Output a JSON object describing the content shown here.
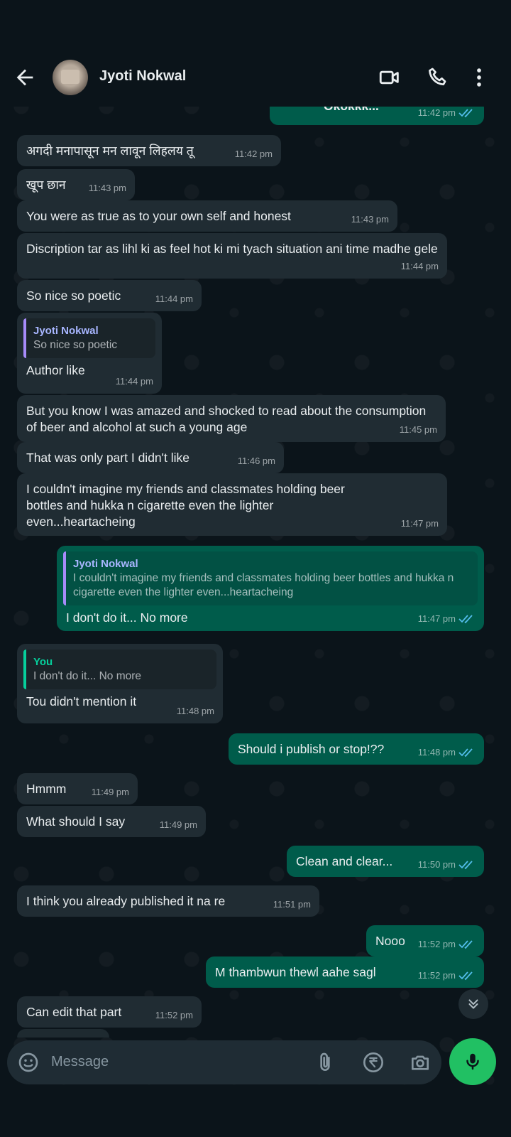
{
  "header": {
    "contact_name": "Jyoti Nokwal",
    "icons": [
      "back-arrow-icon",
      "video-call-icon",
      "voice-call-icon",
      "more-options-icon"
    ]
  },
  "colors": {
    "background": "#0b141a",
    "incoming_bubble": "#202c33",
    "outgoing_bubble": "#005c4b",
    "accent_green": "#21c063",
    "read_ticks": "#53bdeb"
  },
  "messages": [
    {
      "dir": "out",
      "text": "Okokkk...",
      "time": "11:42 pm",
      "read": true
    },
    {
      "dir": "in",
      "text": "अगदी मनापासून मन लावून लिहलय तू",
      "time": "11:42 pm"
    },
    {
      "dir": "in",
      "text": "खूप छान",
      "time": "11:43 pm"
    },
    {
      "dir": "in",
      "text": "You were as true as to your own self and honest",
      "time": "11:43 pm"
    },
    {
      "dir": "in",
      "text": "Discription tar as lihl ki as feel hot ki mi tyach situation ani time madhe gele",
      "time": "11:44 pm"
    },
    {
      "dir": "in",
      "text": "So nice so poetic",
      "time": "11:44 pm"
    },
    {
      "dir": "in",
      "quote_name": "Jyoti Nokwal",
      "quote_text": "So nice so poetic",
      "text": "Author like",
      "time": "11:44 pm"
    },
    {
      "dir": "in",
      "text": "But you know I was amazed and shocked to read about the consumption of beer and alcohol at such a young age",
      "time": "11:45 pm"
    },
    {
      "dir": "in",
      "text": "That was only part I didn't like",
      "time": "11:46 pm"
    },
    {
      "dir": "in",
      "text": "I couldn't imagine my friends and classmates holding beer bottles and hukka n cigarette even the lighter even...heartacheing",
      "time": "11:47 pm"
    },
    {
      "dir": "out",
      "quote_name": "Jyoti Nokwal",
      "quote_text": "I couldn't imagine my friends and classmates holding beer bottles and hukka n cigarette even the lighter even...heartacheing",
      "text": "I don't do it... No more",
      "time": "11:47 pm",
      "read": true
    },
    {
      "dir": "in",
      "quote_name": "You",
      "quote_text": "I don't do it... No more",
      "text": "Tou didn't mention it",
      "time": "11:48 pm"
    },
    {
      "dir": "out",
      "text": "Should i publish or stop!??",
      "time": "11:48 pm",
      "read": true
    },
    {
      "dir": "in",
      "text": "Hmmm",
      "time": "11:49 pm"
    },
    {
      "dir": "in",
      "text": "What should I say",
      "time": "11:49 pm"
    },
    {
      "dir": "out",
      "text": "Clean and clear...",
      "time": "11:50 pm",
      "read": true
    },
    {
      "dir": "in",
      "text": "I think you already published it na re",
      "time": "11:51 pm"
    },
    {
      "dir": "out",
      "text": "Nooo",
      "time": "11:52 pm",
      "read": true
    },
    {
      "dir": "out",
      "text": "M thambwun thewl aahe sagl",
      "time": "11:52 pm",
      "read": true
    },
    {
      "dir": "in",
      "text": "Can edit that part",
      "time": "11:52 pm"
    }
  ],
  "composer": {
    "placeholder": "Message",
    "icons": [
      "emoji-icon",
      "attach-icon",
      "payment-rupee-icon",
      "camera-icon",
      "mic-icon"
    ]
  }
}
